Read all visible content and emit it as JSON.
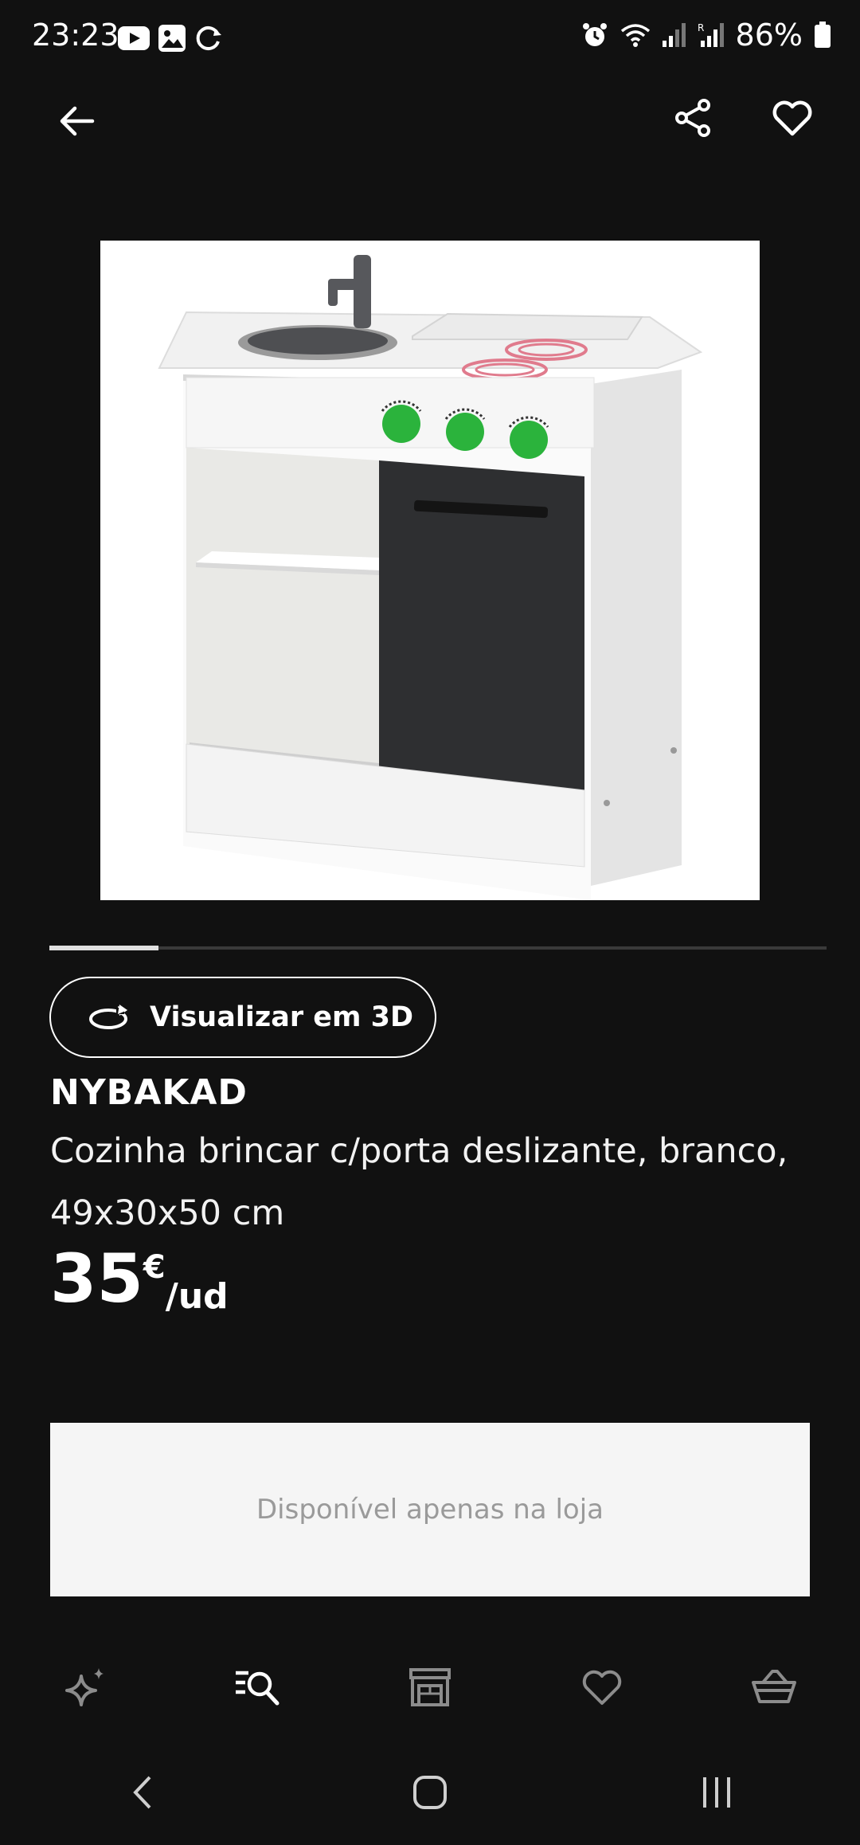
{
  "status_bar": {
    "time": "23:23",
    "battery": "86%",
    "icons": [
      "youtube-icon",
      "gallery-icon",
      "sync-icon",
      "alarm-icon",
      "wifi-icon",
      "signal-icon",
      "signal-r-icon",
      "battery-icon"
    ]
  },
  "top_bar": {
    "back_icon": "arrow-left-icon",
    "share_icon": "share-icon",
    "favorite_icon": "heart-outline-icon"
  },
  "product": {
    "image_alt": "Play kitchen with sliding door",
    "view_3d_label": "Visualizar em 3D",
    "name": "NYBAKAD",
    "description": "Cozinha brincar c/porta deslizante, branco, 49x30x50 cm",
    "price": "35",
    "currency": "€",
    "unit": "/ud",
    "carousel_progress": 0.14
  },
  "availability": {
    "label": "Disponível apenas na loja"
  },
  "bottom_nav": {
    "items": [
      {
        "name": "inspiration",
        "icon": "sparkle-icon",
        "active": false
      },
      {
        "name": "search",
        "icon": "search-list-icon",
        "active": true
      },
      {
        "name": "store",
        "icon": "store-icon",
        "active": false
      },
      {
        "name": "favourites",
        "icon": "heart-icon",
        "active": false
      },
      {
        "name": "basket",
        "icon": "basket-icon",
        "active": false
      }
    ]
  },
  "colors": {
    "background": "#111111",
    "text": "#ffffff",
    "muted_icon": "#8c8c8c",
    "availability_bg": "#f5f5f5",
    "availability_text": "#9a9a9a",
    "knob_green": "#2bb33c"
  }
}
